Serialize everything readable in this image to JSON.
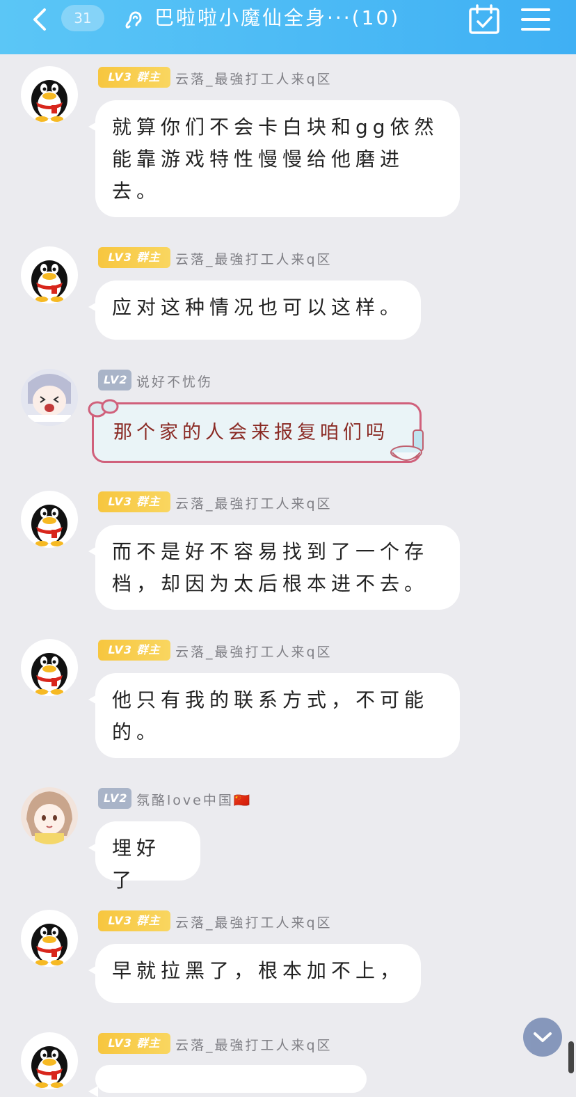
{
  "header": {
    "back_icon": "chevron-left-icon",
    "unread_count": "31",
    "title": "巴啦啦小魔仙全身···(10)",
    "ear_icon": "ear-icon",
    "calendar_icon": "calendar-check-icon",
    "menu_icon": "menu-icon"
  },
  "messages": [
    {
      "level": "LV3",
      "role": "群主",
      "sender": "云落_最強打工人来q区",
      "text": "就算你们不会卡白块和gg依然能靠游戏特性慢慢给他磨进去。"
    },
    {
      "level": "LV3",
      "role": "群主",
      "sender": "云落_最強打工人来q区",
      "text": "应对这种情况也可以这样。"
    },
    {
      "level": "LV2",
      "role": "",
      "sender": "说好不忧伤",
      "text": "那个家的人会来报复咱们吗"
    },
    {
      "level": "LV3",
      "role": "群主",
      "sender": "云落_最強打工人来q区",
      "text": "而不是好不容易找到了一个存档，却因为太后根本进不去。"
    },
    {
      "level": "LV3",
      "role": "群主",
      "sender": "云落_最強打工人来q区",
      "text": "他只有我的联系方式，不可能的。"
    },
    {
      "level": "LV2",
      "role": "",
      "sender": "氛酪love中国🇨🇳",
      "text": "埋好了"
    },
    {
      "level": "LV3",
      "role": "群主",
      "sender": "云落_最強打工人来q区",
      "text": "早就拉黑了，根本加不上，"
    },
    {
      "level": "LV3",
      "role": "群主",
      "sender": "云落_最強打工人来q区",
      "text": ""
    }
  ],
  "scroll_fab_icon": "chevron-down-icon",
  "colors": {
    "header": "#4ab9f5",
    "lv3": "#f7c63f",
    "lv2": "#a9b4c8",
    "background": "#ebebef"
  }
}
